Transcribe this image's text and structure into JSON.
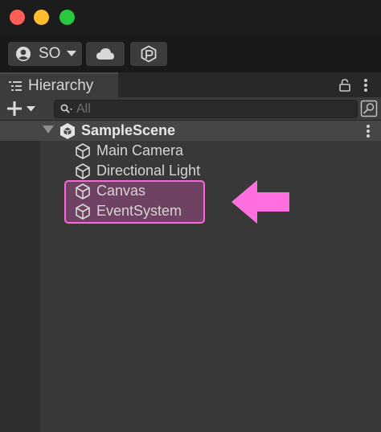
{
  "window": {
    "controls": [
      "close",
      "minimize",
      "zoom"
    ]
  },
  "toolbar": {
    "account_label": "SO",
    "account_icon": "account-icon",
    "cloud_icon": "cloud-icon",
    "collab_icon": "collab-icon"
  },
  "hierarchy": {
    "tab_label": "Hierarchy",
    "search_placeholder": "All",
    "scene": {
      "name": "SampleScene"
    },
    "objects": [
      {
        "name": "Main Camera"
      },
      {
        "name": "Directional Light"
      },
      {
        "name": "Canvas"
      },
      {
        "name": "EventSystem"
      }
    ]
  },
  "annotation": {
    "highlighted": [
      "Canvas",
      "EventSystem"
    ],
    "color": "#ff66dd"
  }
}
